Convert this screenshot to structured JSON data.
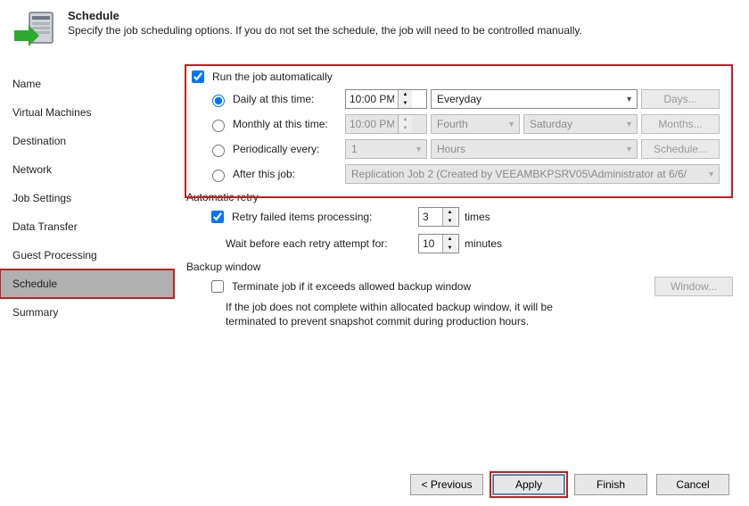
{
  "header": {
    "title": "Schedule",
    "subtitle": "Specify the job scheduling options. If you do not set the schedule, the job will need to be controlled manually."
  },
  "sidebar": {
    "items": [
      {
        "label": "Name"
      },
      {
        "label": "Virtual Machines"
      },
      {
        "label": "Destination"
      },
      {
        "label": "Network"
      },
      {
        "label": "Job Settings"
      },
      {
        "label": "Data Transfer"
      },
      {
        "label": "Guest Processing"
      },
      {
        "label": "Schedule"
      },
      {
        "label": "Summary"
      }
    ],
    "selectedIndex": 7
  },
  "schedule": {
    "run_auto_label": "Run the job automatically",
    "daily_label": "Daily at this time:",
    "daily_time": "10:00 PM",
    "daily_day": "Everyday",
    "days_btn": "Days...",
    "monthly_label": "Monthly at this time:",
    "monthly_time": "10:00 PM",
    "monthly_ord": "Fourth",
    "monthly_dow": "Saturday",
    "months_btn": "Months...",
    "periodic_label": "Periodically every:",
    "periodic_val": "1",
    "periodic_unit": "Hours",
    "schedule_btn": "Schedule...",
    "after_label": "After this job:",
    "after_value": "Replication Job 2 (Created by VEEAMBKPSRV05\\Administrator at 6/6/"
  },
  "retry": {
    "section": "Automatic retry",
    "retry_label": "Retry failed items processing:",
    "retry_count": "3",
    "times": "times",
    "wait_label": "Wait before each retry attempt for:",
    "wait_min": "10",
    "minutes": "minutes"
  },
  "window": {
    "section": "Backup window",
    "terminate_label": "Terminate job if it exceeds allowed backup window",
    "window_btn": "Window...",
    "note": "If the job does not complete within allocated backup window, it will be terminated to prevent snapshot commit during production hours."
  },
  "footer": {
    "previous": "< Previous",
    "apply": "Apply",
    "finish": "Finish",
    "cancel": "Cancel"
  }
}
